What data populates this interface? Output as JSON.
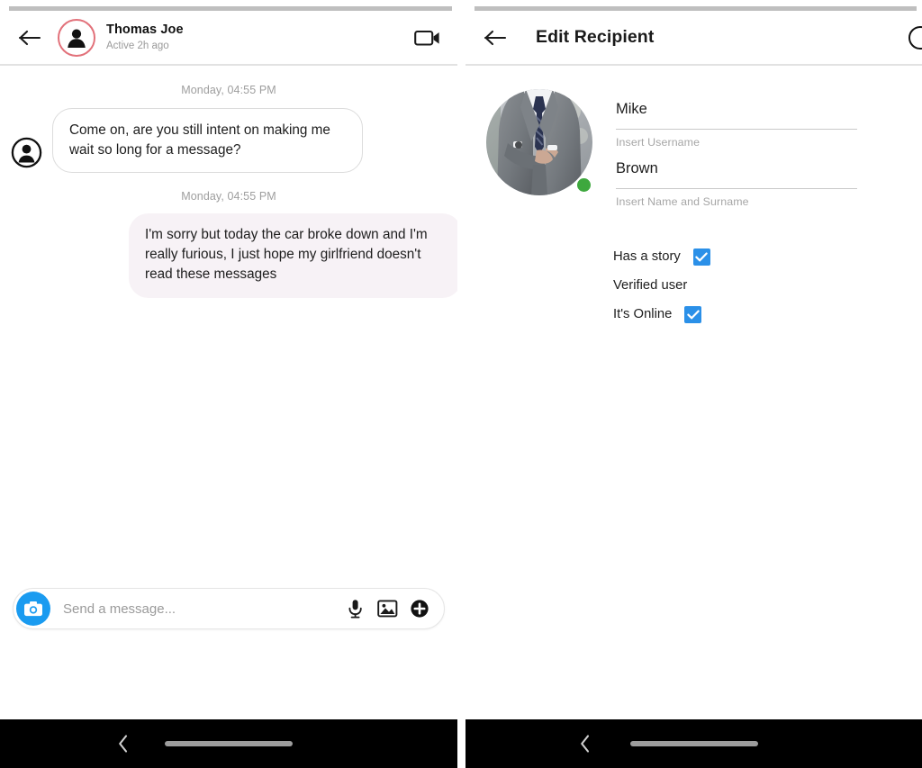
{
  "left_panel": {
    "header": {
      "back_icon": "back-arrow-icon",
      "avatar_icon": "person-avatar-icon",
      "name": "Thomas Joe",
      "status": "Active 2h ago",
      "video_icon": "video-camera-icon",
      "story_ring_color": "#e2717a"
    },
    "messages": [
      {
        "timestamp": "Monday, 04:55 PM",
        "direction": "incoming",
        "text": "Come on, are you still intent on making me wait so long for a message?",
        "avatar_icon": "person-circle-icon"
      },
      {
        "timestamp": "Monday, 04:55 PM",
        "direction": "outgoing",
        "text": "I'm sorry but today the car broke down and I'm really furious, I just hope my girlfriend doesn't read these messages"
      }
    ],
    "composer": {
      "camera_icon": "camera-icon",
      "placeholder": "Send a message...",
      "value": "",
      "mic_icon": "microphone-icon",
      "gallery_icon": "image-icon",
      "plus_icon": "plus-circle-icon",
      "camera_button_color": "#1a9bf0"
    },
    "navbar": {
      "back_icon": "chevron-left-icon",
      "home_pill": "home-indicator"
    }
  },
  "right_panel": {
    "header": {
      "back_icon": "back-arrow-icon",
      "title": "Edit Recipient",
      "edge_icon": "profile-circle-icon"
    },
    "profile": {
      "photo_alt": "man-in-grey-suit-photo",
      "online_indicator": "online-dot",
      "online_color": "#3ea83e"
    },
    "fields": [
      {
        "value": "Mike",
        "hint": "Insert Username"
      },
      {
        "value": "Brown",
        "hint": "Insert Name and Surname"
      }
    ],
    "checkboxes": [
      {
        "label": "Has a story",
        "checked": true
      },
      {
        "label": "Verified user",
        "checked": false
      },
      {
        "label": "It's Online",
        "checked": true
      }
    ],
    "checkbox_color": "#2b90e8",
    "navbar": {
      "back_icon": "chevron-left-icon",
      "home_pill": "home-indicator"
    }
  }
}
